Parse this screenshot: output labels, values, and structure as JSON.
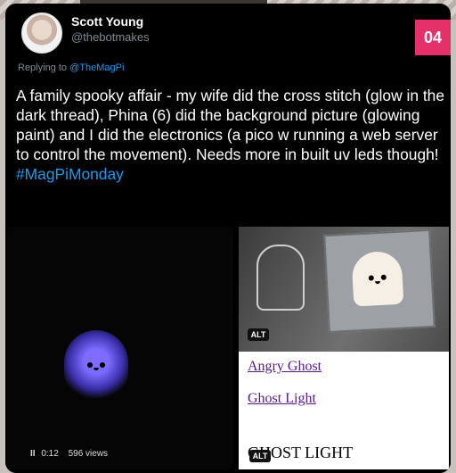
{
  "badge": "04",
  "tweet": {
    "author_name": "Scott Young",
    "author_handle": "@thebotmakes",
    "reply_prefix": "Replying to",
    "reply_mention": "@TheMagPi",
    "text": "A family spooky affair - my wife did the cross stitch (glow in the dark thread), Phina (6) did the background picture (glowing paint) and I did the electronics (a pico w running a web server to control the movement). Needs more in built uv leds though!",
    "hashtag": "#MagPiMonday"
  },
  "video": {
    "pause_icon": "II",
    "time": "0:12",
    "views": "596 views"
  },
  "photo": {
    "alt_label": "ALT"
  },
  "links_panel": {
    "link1": "Angry Ghost",
    "link2": "Ghost Light",
    "heading": "GHOST LIGHT",
    "alt_label": "ALT"
  },
  "colors": {
    "badge": "#e5316a",
    "link": "#551a8b",
    "mention": "#1d9bf0"
  }
}
